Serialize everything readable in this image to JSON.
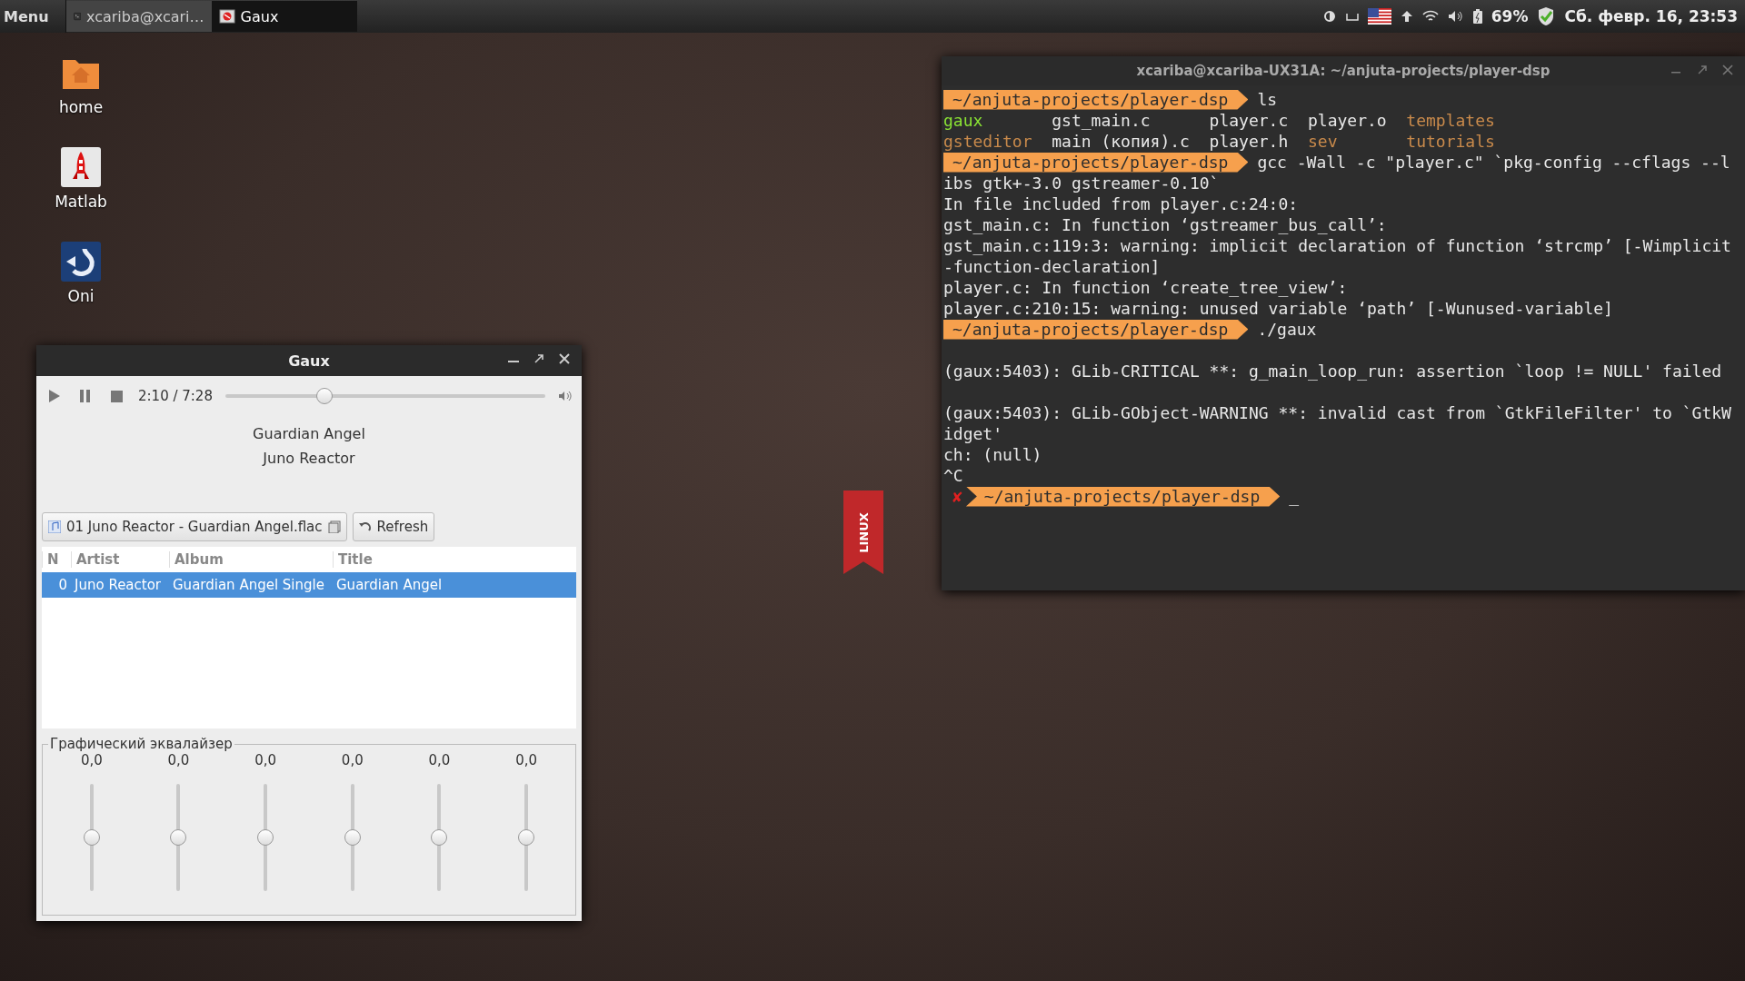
{
  "panel": {
    "menu": "Menu",
    "tasks": [
      {
        "label": "xcariba@xcari…",
        "kind": "terminal",
        "selected": false
      },
      {
        "label": "Gaux",
        "kind": "app",
        "selected": true
      }
    ],
    "battery": "69%",
    "clock": "Сб. февр. 16, 23:53"
  },
  "desktop_icons": [
    {
      "label": "home",
      "kind": "folder"
    },
    {
      "label": "Matlab",
      "kind": "rocket"
    },
    {
      "label": "Oni",
      "kind": "oni"
    }
  ],
  "wallpaper_ribbon": "LINUX",
  "player": {
    "title": "Gaux",
    "time": "2:10 / 7:28",
    "level": 0.3,
    "song": "Guardian Angel",
    "artist": "Juno Reactor",
    "file": "01 Juno Reactor - Guardian Angel.flac",
    "refresh": "Refresh",
    "columns": [
      "N",
      "Artist",
      "Album",
      "Title"
    ],
    "rows": [
      {
        "cells": [
          "0",
          "Juno Reactor",
          "Guardian Angel Single",
          "Guardian Angel"
        ],
        "selected": true
      }
    ],
    "equalizer": {
      "label": "Графический эквалайзер",
      "bands": [
        {
          "value": "0,0",
          "level": 0.5
        },
        {
          "value": "0,0",
          "level": 0.5
        },
        {
          "value": "0,0",
          "level": 0.5
        },
        {
          "value": "0,0",
          "level": 0.5
        },
        {
          "value": "0,0",
          "level": 0.5
        },
        {
          "value": "0,0",
          "level": 0.5
        }
      ]
    }
  },
  "terminal": {
    "title": "xcariba@xcariba-UX31A: ~/anjuta-projects/player-dsp",
    "lines": [
      {
        "kind": "prompt",
        "path": "~/anjuta-projects/player-dsp",
        "command": "ls"
      },
      {
        "kind": "listing",
        "items": [
          {
            "text": "gaux",
            "color": "#8ae234"
          },
          {
            "text": "gst_main.c",
            "color": "#e8e8e8"
          },
          {
            "text": "player.c",
            "color": "#e8e8e8"
          },
          {
            "text": "player.o",
            "color": "#e8e8e8"
          },
          {
            "text": "templates",
            "color": "#c98a4b"
          }
        ]
      },
      {
        "kind": "listing",
        "items": [
          {
            "text": "gsteditor",
            "color": "#c98a4b"
          },
          {
            "text": "main (копия).c",
            "color": "#e8e8e8"
          },
          {
            "text": "player.h",
            "color": "#e8e8e8"
          },
          {
            "text": "sev",
            "color": "#c98a4b"
          },
          {
            "text": "tutorials",
            "color": "#c98a4b"
          }
        ]
      },
      {
        "kind": "prompt",
        "path": "~/anjuta-projects/player-dsp",
        "command": "gcc -Wall -c \"player.c\" `pkg-config --cflags --l"
      },
      {
        "kind": "text",
        "text": "ibs gtk+-3.0 gstreamer-0.10`"
      },
      {
        "kind": "text",
        "text": "In file included from player.c:24:0:"
      },
      {
        "kind": "text",
        "text": "gst_main.c: In function ‘gstreamer_bus_call’:"
      },
      {
        "kind": "text",
        "text": "gst_main.c:119:3: warning: implicit declaration of function ‘strcmp’ [-Wimplicit"
      },
      {
        "kind": "text",
        "text": "-function-declaration]"
      },
      {
        "kind": "text",
        "text": "player.c: In function ‘create_tree_view’:"
      },
      {
        "kind": "text",
        "text": "player.c:210:15: warning: unused variable ‘path’ [-Wunused-variable]"
      },
      {
        "kind": "prompt",
        "path": "~/anjuta-projects/player-dsp",
        "command": "./gaux"
      },
      {
        "kind": "blank"
      },
      {
        "kind": "text",
        "text": "(gaux:5403): GLib-CRITICAL **: g_main_loop_run: assertion `loop != NULL' failed"
      },
      {
        "kind": "blank"
      },
      {
        "kind": "text",
        "text": "(gaux:5403): GLib-GObject-WARNING **: invalid cast from `GtkFileFilter' to `GtkW"
      },
      {
        "kind": "text",
        "text": "idget'"
      },
      {
        "kind": "text",
        "text": "ch: (null)"
      },
      {
        "kind": "text",
        "text": "^C"
      },
      {
        "kind": "prompt",
        "status": "✘",
        "path": "~/anjuta-projects/player-dsp",
        "cursor": "_"
      }
    ]
  }
}
